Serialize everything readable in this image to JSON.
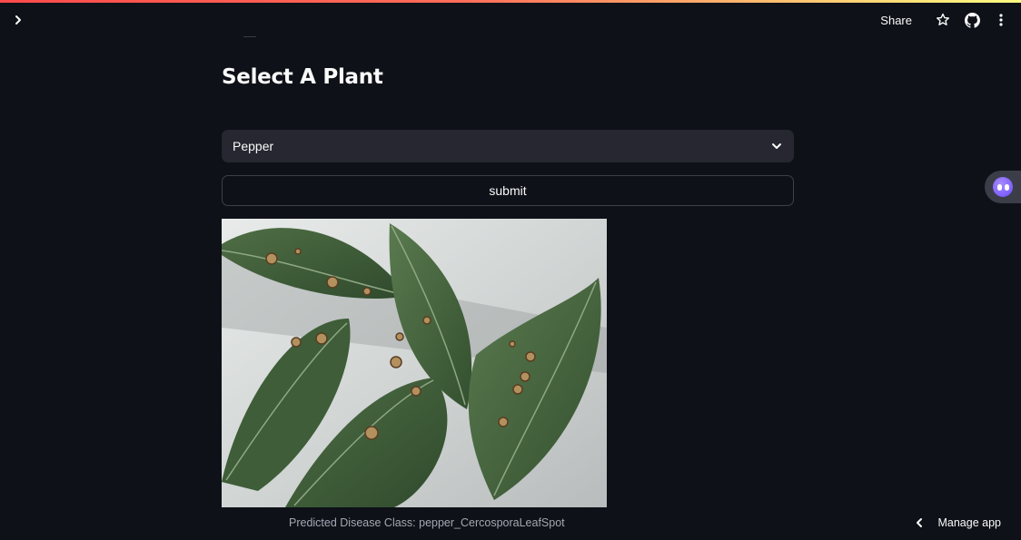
{
  "header": {
    "share_label": "Share",
    "icons": [
      "chevron-right-icon",
      "star-icon",
      "github-icon",
      "more-vertical-icon"
    ]
  },
  "main": {
    "title": "Select A Plant",
    "plant_select": {
      "value": "Pepper"
    },
    "submit_label": "submit",
    "image_subject": "pepper leaves with cercospora leaf spot",
    "prediction_text": "Predicted Disease Class: pepper_CercosporaLeafSpot"
  },
  "footer": {
    "manage_app_label": "Manage app"
  },
  "colors": {
    "background": "#0e1117",
    "select_background": "#262730",
    "button_border": "#3d404a",
    "text": "#fafafa",
    "muted_text": "#a3a8b4",
    "accent_stripe_start": "#ff4b4b",
    "accent_stripe_end": "#fffd80"
  }
}
